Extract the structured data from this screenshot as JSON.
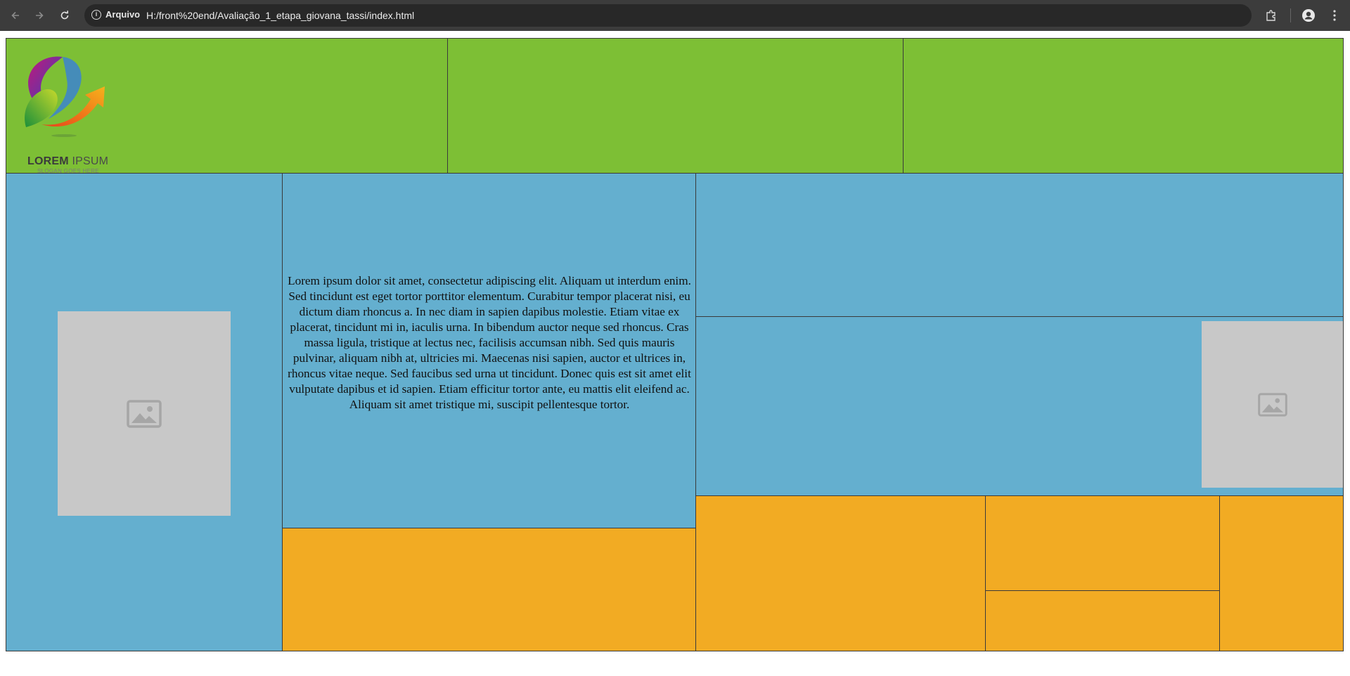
{
  "browser": {
    "security_label": "Arquivo",
    "url": "H:/front%20end/Avaliação_1_etapa_giovana_tassi/index.html"
  },
  "header": {
    "logo": {
      "brand_bold": "LOREM",
      "brand_light": "IPSUM",
      "slogan": "SLOGAN GOES HERE"
    }
  },
  "main": {
    "paragraph": "Lorem ipsum dolor sit amet, consectetur adipiscing elit. Aliquam ut interdum enim. Sed tincidunt est eget tortor porttitor elementum. Curabitur tempor placerat nisi, eu dictum diam rhoncus a. In nec diam in sapien dapibus molestie. Etiam vitae ex placerat, tincidunt mi in, iaculis urna. In bibendum auctor neque sed rhoncus. Cras massa ligula, tristique at lectus nec, facilisis accumsan nibh. Sed quis mauris pulvinar, aliquam nibh at, ultricies mi. Maecenas nisi sapien, auctor et ultrices in, rhoncus vitae neque. Sed faucibus sed urna ut tincidunt. Donec quis est sit amet elit vulputate dapibus et id sapien. Etiam efficitur tortor ante, eu mattis elit eleifend ac. Aliquam sit amet tristique mi, suscipit pellentesque tortor."
  },
  "colors": {
    "header_green": "#7dbf35",
    "section_blue": "#64afcf",
    "footer_orange": "#f2ab23",
    "placeholder_gray": "#c8c8c8"
  },
  "icons": [
    "back-arrow-icon",
    "forward-arrow-icon",
    "reload-icon",
    "info-icon",
    "extensions-icon",
    "profile-icon",
    "more-menu-icon",
    "image-placeholder-icon"
  ]
}
